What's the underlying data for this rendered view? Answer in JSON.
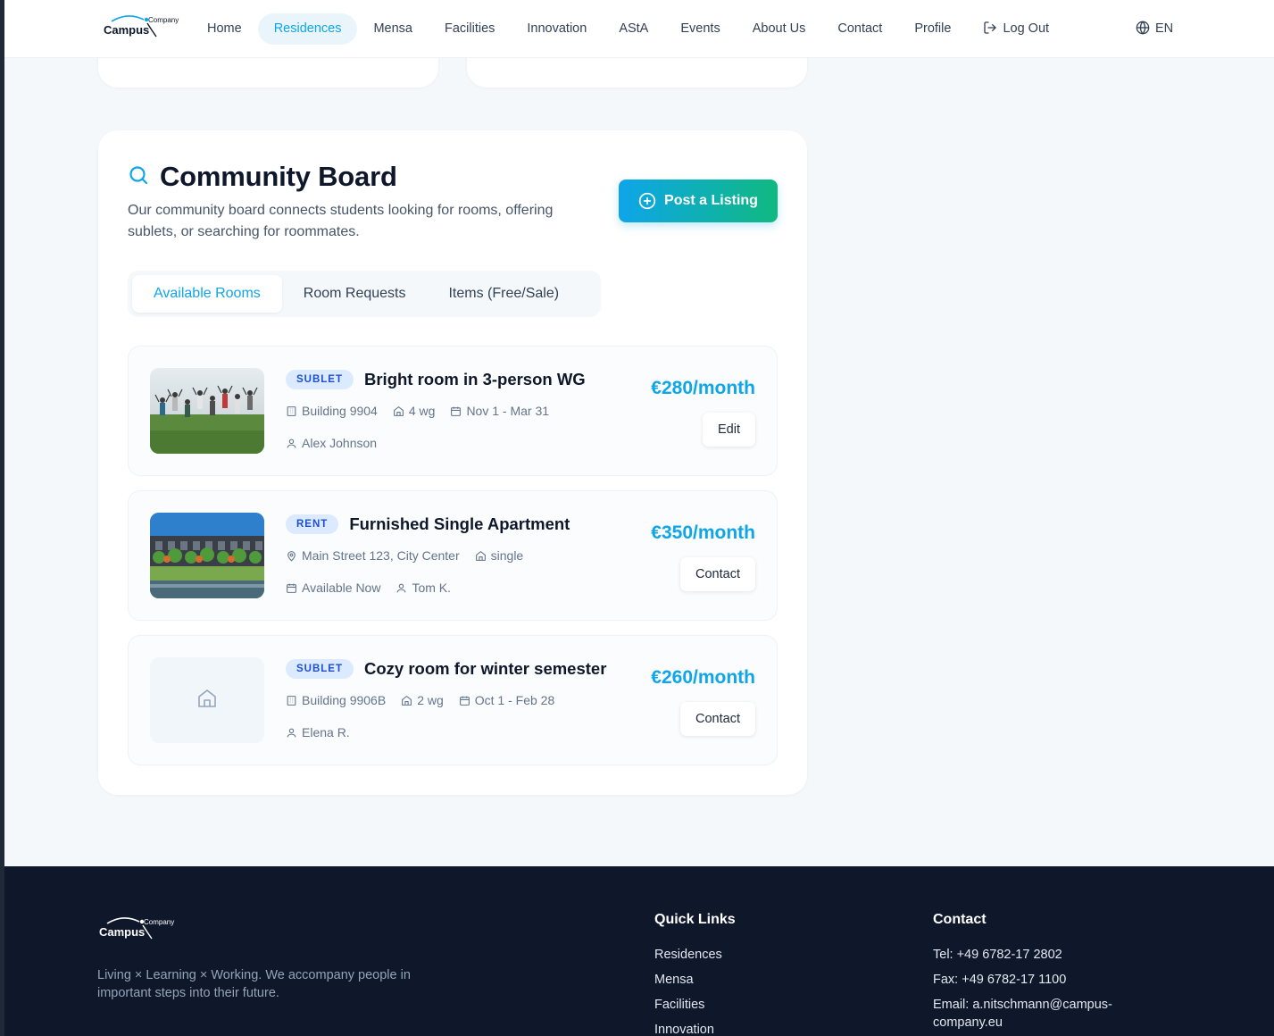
{
  "header": {
    "logo": {
      "word": "Campus",
      "sub": "Company"
    },
    "nav": [
      {
        "label": "Home",
        "active": false
      },
      {
        "label": "Residences",
        "active": true
      },
      {
        "label": "Mensa",
        "active": false
      },
      {
        "label": "Facilities",
        "active": false
      },
      {
        "label": "Innovation",
        "active": false
      },
      {
        "label": "AStA",
        "active": false
      },
      {
        "label": "Events",
        "active": false
      },
      {
        "label": "About Us",
        "active": false
      },
      {
        "label": "Contact",
        "active": false
      },
      {
        "label": "Profile",
        "active": false
      }
    ],
    "logout_label": "Log Out",
    "language": "EN"
  },
  "board": {
    "title": "Community Board",
    "description": "Our community board connects students looking for rooms, offering sublets, or searching for roommates.",
    "post_button": "Post a Listing",
    "tabs": [
      {
        "label": "Available Rooms",
        "active": true
      },
      {
        "label": "Room Requests",
        "active": false
      },
      {
        "label": "Items (Free/Sale)",
        "active": false
      }
    ],
    "listings": [
      {
        "badge": "SUBLET",
        "title": "Bright room in 3-person WG",
        "location": "Building 9904",
        "type": "4 wg",
        "dates": "Nov 1 - Mar 31",
        "person": "Alex Johnson",
        "price": "€280/month",
        "action": "Edit",
        "image": "people-jumping-photo"
      },
      {
        "badge": "RENT",
        "title": "Furnished Single Apartment",
        "location": "Main Street 123, City Center",
        "type": "single",
        "dates": "Available Now",
        "person": "Tom K.",
        "price": "€350/month",
        "action": "Contact",
        "image": "building-photo"
      },
      {
        "badge": "SUBLET",
        "title": "Cozy room for winter semester",
        "location": "Building 9906B",
        "type": "2 wg",
        "dates": "Oct 1 - Feb 28",
        "person": "Elena R.",
        "price": "€260/month",
        "action": "Contact",
        "image": "home-icon-placeholder"
      }
    ]
  },
  "footer": {
    "tagline": "Living × Learning × Working. We accompany people in important steps into their future.",
    "quick_links": {
      "title": "Quick Links",
      "items": [
        "Residences",
        "Mensa",
        "Facilities",
        "Innovation"
      ]
    },
    "contact": {
      "title": "Contact",
      "tel": "Tel: +49 6782-17 2802",
      "fax": "Fax: +49 6782-17 1100",
      "email": "Email: a.nitschmann@campus-company.eu"
    }
  },
  "colors": {
    "accent": "#0ea5e9",
    "accent_green": "#10b981",
    "badge_bg": "#dbeafe",
    "footer_bg": "#0f172a",
    "page_bg": "#f4f8fb"
  }
}
